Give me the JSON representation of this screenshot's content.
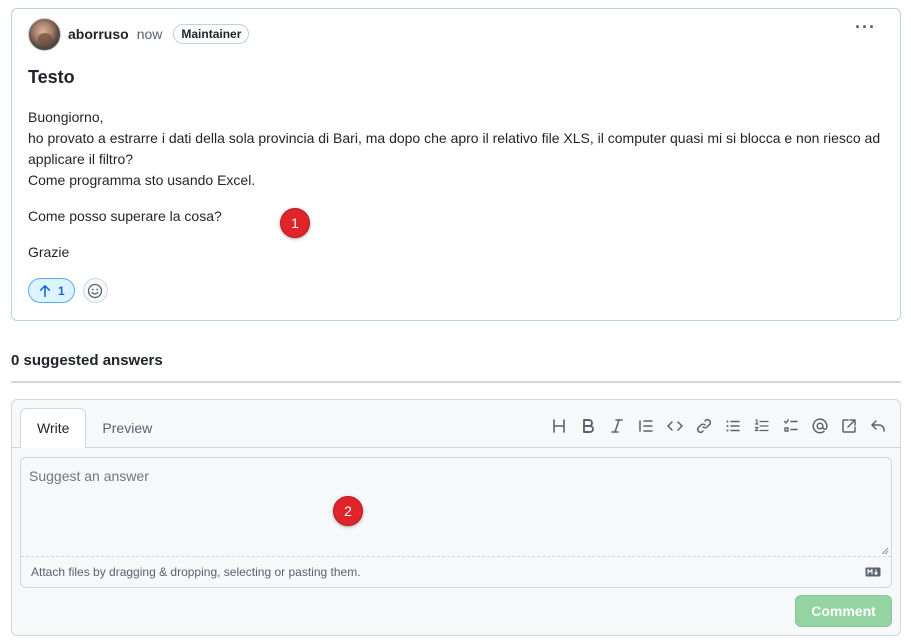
{
  "post": {
    "author": "aborruso",
    "time": "now",
    "role_badge": "Maintainer",
    "menu_glyph": "···",
    "title": "Testo",
    "body": [
      "Buongiorno,",
      "ho provato a estrarre i dati della sola provincia di Bari, ma dopo che apro il relativo file XLS, il computer quasi mi si blocca e non riesco ad applicare il filtro?",
      "Come programma sto usando Excel.",
      "Come posso superare la cosa?",
      "Grazie"
    ],
    "upvote_count": "1"
  },
  "markers": [
    "1",
    "2"
  ],
  "answers": {
    "heading": "0 suggested answers"
  },
  "editor": {
    "tabs": [
      "Write",
      "Preview"
    ],
    "toolbar": [
      "heading-icon",
      "bold-icon",
      "italic-icon",
      "quote-icon",
      "code-icon",
      "link-icon",
      "unordered-list-icon",
      "ordered-list-icon",
      "task-list-icon",
      "mention-icon",
      "cross-reference-icon",
      "reply-icon"
    ],
    "placeholder": "Suggest an answer",
    "attach_hint": "Attach files by dragging & dropping, selecting or pasting them.",
    "md_badge": "MD",
    "submit_label": "Comment"
  },
  "colors": {
    "accent_blue": "#0969da",
    "upvote_bg": "#ddf4ff",
    "comment_disabled": "#94d3a2",
    "marker_red": "#e0242a"
  }
}
